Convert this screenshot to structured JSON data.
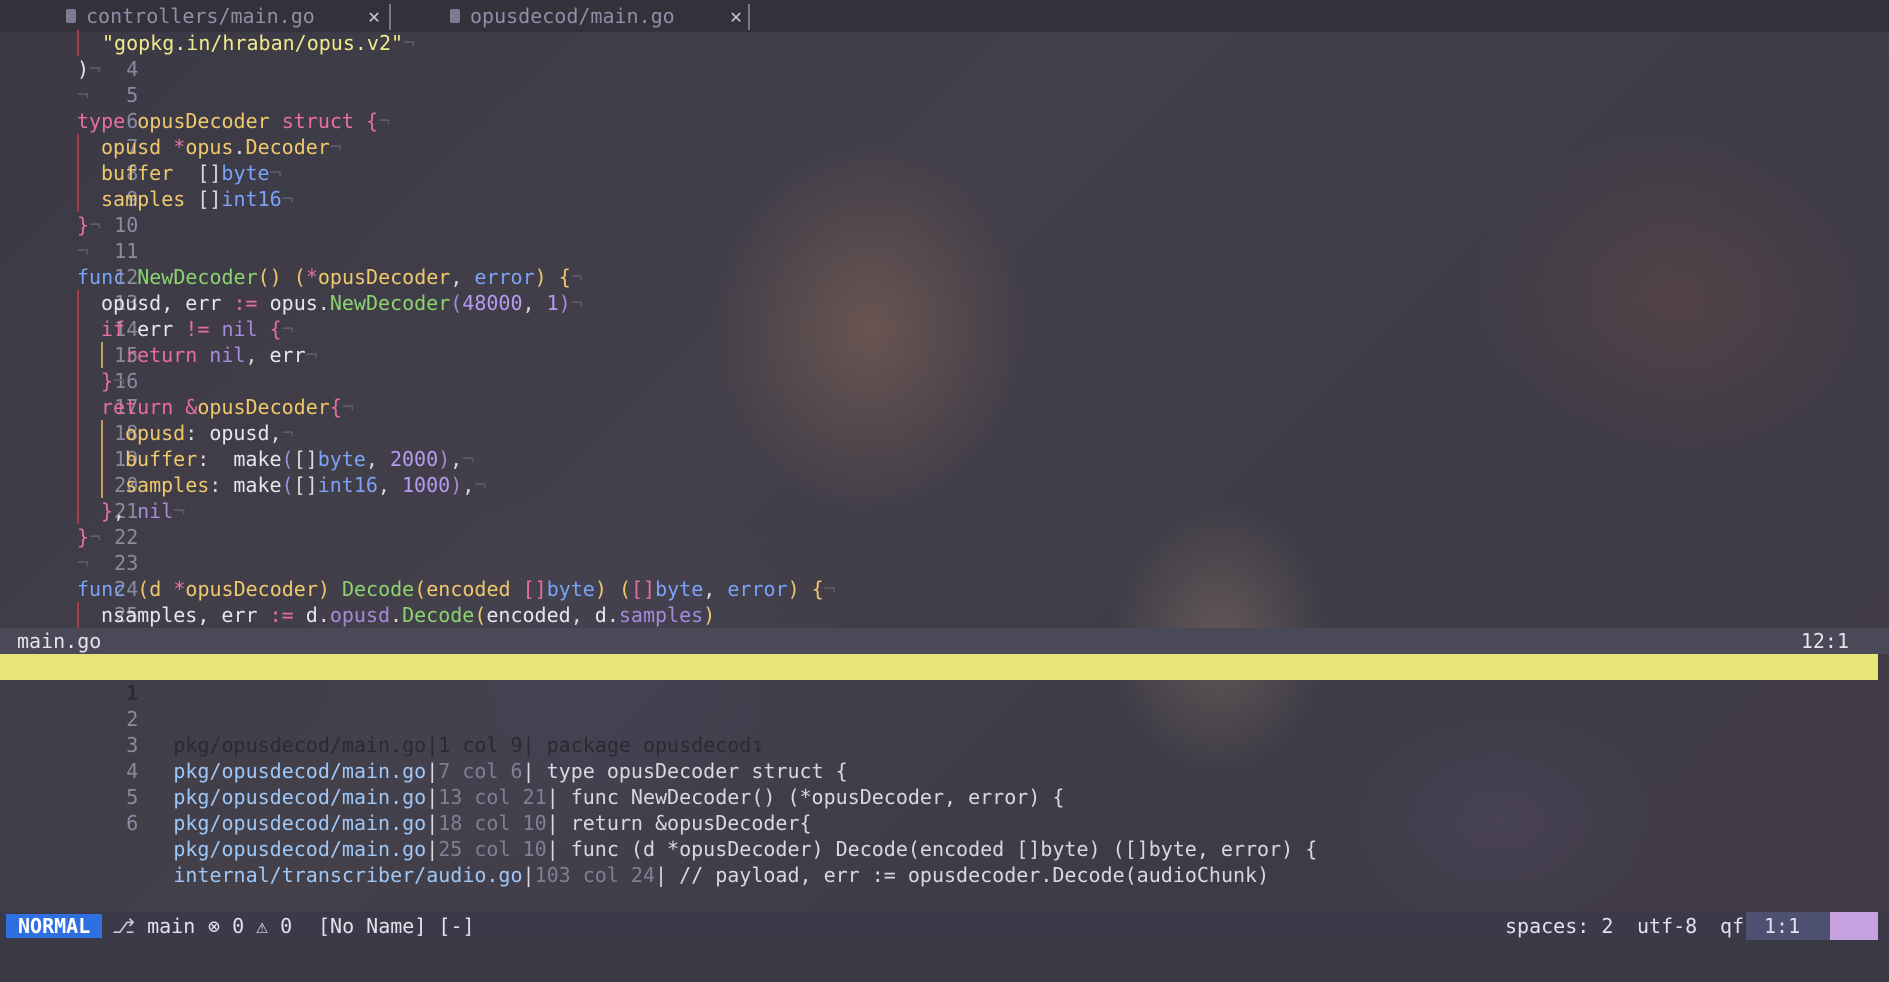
{
  "tabs": [
    {
      "label": "controllers/main.go",
      "close": "✕"
    },
    {
      "label": "opusdecod/main.go",
      "close": "✕"
    }
  ],
  "code_lines": [
    {
      "num": "4",
      "text": "\"gopkg.in/hraban/opus.v2\""
    },
    {
      "num": "5",
      "text": ")"
    },
    {
      "num": "6",
      "text": ""
    },
    {
      "num": "7",
      "text": "type opusDecoder struct {"
    },
    {
      "num": "8",
      "text": "opusd *opus.Decoder"
    },
    {
      "num": "9",
      "text": "buffer  []byte"
    },
    {
      "num": "10",
      "text": "samples []int16"
    },
    {
      "num": "11",
      "text": "}"
    },
    {
      "num": "12",
      "text": ""
    },
    {
      "num": "13",
      "text": "func NewDecoder() (*opusDecoder, error) {"
    },
    {
      "num": "14",
      "text": "opusd, err := opus.NewDecoder(48000, 1)"
    },
    {
      "num": "15",
      "text": "if err != nil {"
    },
    {
      "num": "16",
      "text": "return nil, err"
    },
    {
      "num": "17",
      "text": "}"
    },
    {
      "num": "18",
      "text": "return &opusDecoder{"
    },
    {
      "num": "19",
      "text": "opusd: opusd,"
    },
    {
      "num": "20",
      "text": "buffer:  make([]byte, 2000),"
    },
    {
      "num": "21",
      "text": "samples: make([]int16, 1000),"
    },
    {
      "num": "22",
      "text": "}, nil"
    },
    {
      "num": "23",
      "text": "}"
    },
    {
      "num": "24",
      "text": ""
    },
    {
      "num": "25",
      "text": "func (d *opusDecoder) Decode(encoded []byte) ([]byte, error) {"
    },
    {
      "num": "26",
      "text": "nsamples, err := d.opusd.Decode(encoded, d.samples)"
    }
  ],
  "window_bar": {
    "filename": "main.go",
    "position": "12:1"
  },
  "quickfix": [
    {
      "num": "1",
      "file": "pkg/opusdecod/main.go",
      "loc": "1 col 9",
      "text": "package opusdecod"
    },
    {
      "num": "2",
      "file": "pkg/opusdecod/main.go",
      "loc": "7 col 6",
      "text": "type opusDecoder struct {"
    },
    {
      "num": "3",
      "file": "pkg/opusdecod/main.go",
      "loc": "13 col 21",
      "text": "func NewDecoder() (*opusDecoder, error) {"
    },
    {
      "num": "4",
      "file": "pkg/opusdecod/main.go",
      "loc": "18 col 10",
      "text": "return &opusDecoder{"
    },
    {
      "num": "5",
      "file": "pkg/opusdecod/main.go",
      "loc": "25 col 10",
      "text": "func (d *opusDecoder) Decode(encoded []byte) ([]byte, error) {"
    },
    {
      "num": "6",
      "file": "internal/transcriber/audio.go",
      "loc": "103 col 24",
      "text": "// payload, err := opusdecoder.Decode(audioChunk)"
    }
  ],
  "statusline": {
    "mode": "NORMAL",
    "branch_icon": "git-branch-icon",
    "branch": "main",
    "errors": "0",
    "warnings": "0",
    "buffer_name": "[No Name] [-]",
    "indent": "spaces: 2",
    "encoding": "utf-8",
    "filetype": "qf",
    "cursor": "1:1"
  },
  "colors": {
    "mode_bg": "#2f6fe0",
    "current_qf_line": "#e8e47a",
    "keyword": "#e86e9e",
    "type": "#f0c86c",
    "function": "#8bd36e",
    "number": "#b39df3"
  }
}
